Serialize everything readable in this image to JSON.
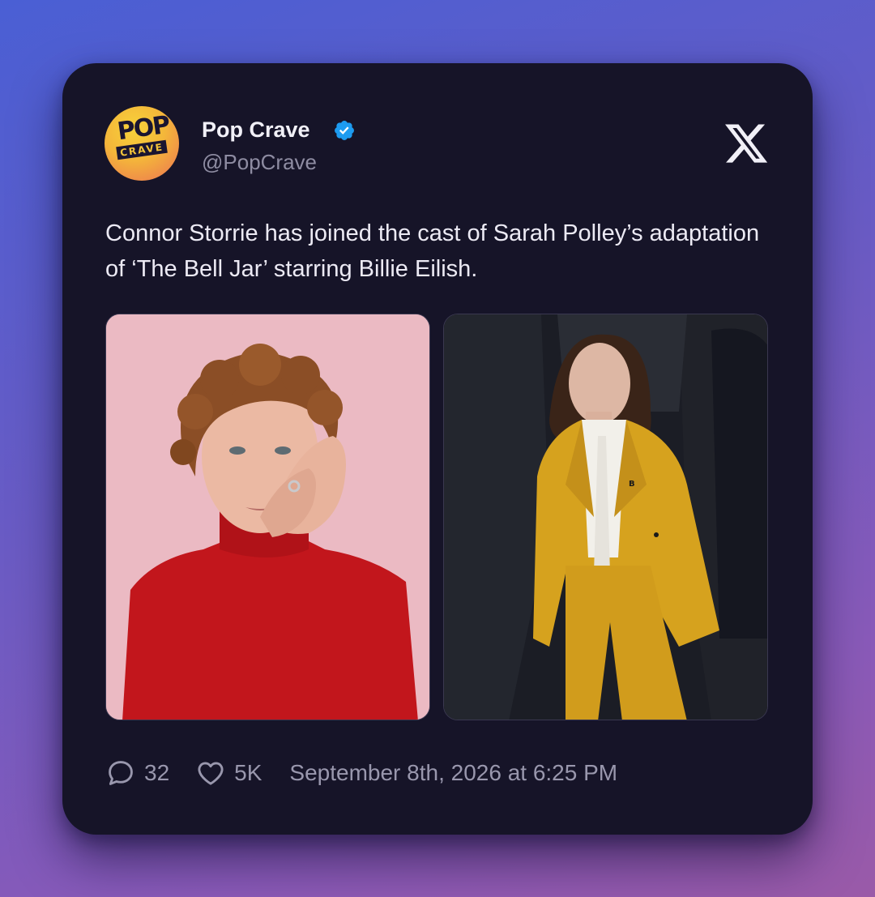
{
  "tweet": {
    "author_name": "Pop Crave",
    "author_handle": "@PopCrave",
    "avatar": {
      "line1": "POP",
      "line2": "CRAVE"
    },
    "verified_icon": "verified-badge-icon",
    "platform_icon": "x-logo-icon",
    "text": "Connor Storrie has joined the cast of Sarah Polley’s adaptation of ‘The Bell Jar’ starring Billie Eilish.",
    "images": [
      {
        "name": "connor-storrie-photo"
      },
      {
        "name": "billie-eilish-photo"
      }
    ],
    "reply_count": "32",
    "like_count": "5K",
    "timestamp": "September 8th, 2026 at 6:25 PM"
  },
  "colors": {
    "card_background": "#161428",
    "verified": "#1d9bf0",
    "text_primary": "#eceaf4",
    "text_secondary": "#8e8ca2"
  }
}
